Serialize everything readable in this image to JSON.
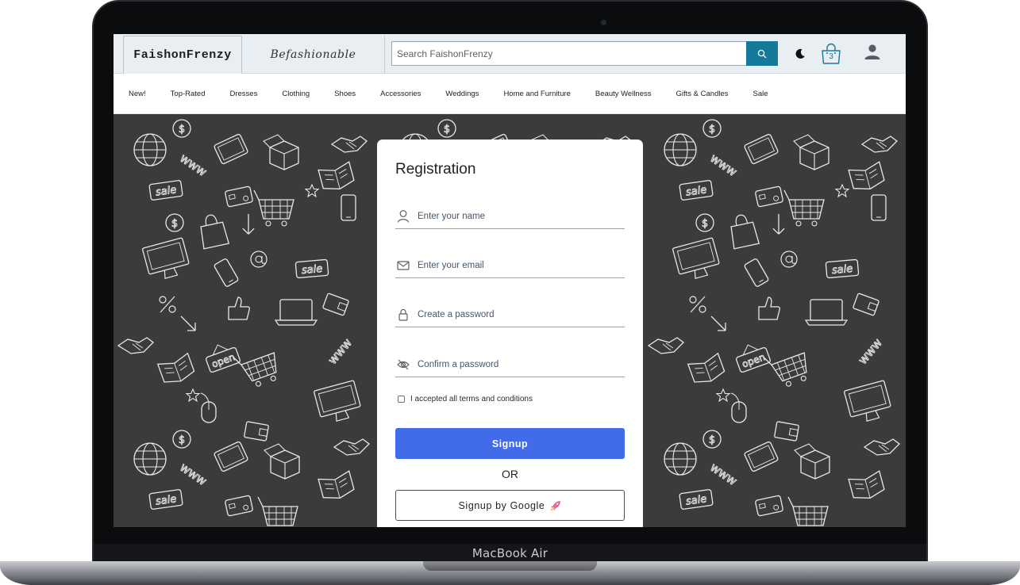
{
  "device": {
    "label": "MacBook Air"
  },
  "header": {
    "brand": "FaishonFrenzy",
    "tagline": "Befashionable",
    "search": {
      "placeholder": "Search FaishonFrenzy",
      "icon": "search-icon"
    },
    "theme_toggle_icon": "moon-icon",
    "cart": {
      "icon": "shopping-bag-icon",
      "count": "3"
    },
    "account_icon": "user-icon"
  },
  "nav": {
    "items": [
      {
        "label": "New!"
      },
      {
        "label": "Top-Rated"
      },
      {
        "label": "Dresses"
      },
      {
        "label": "Clothing"
      },
      {
        "label": "Shoes"
      },
      {
        "label": "Accessories"
      },
      {
        "label": "Weddings"
      },
      {
        "label": "Home and Furniture"
      },
      {
        "label": "Beauty Wellness"
      },
      {
        "label": "Gifts & Candles"
      },
      {
        "label": "Sale"
      }
    ]
  },
  "registration": {
    "title": "Registration",
    "fields": [
      {
        "icon": "user-icon",
        "placeholder": "Enter your name",
        "value": ""
      },
      {
        "icon": "envelope-icon",
        "placeholder": "Enter your email",
        "value": ""
      },
      {
        "icon": "lock-icon",
        "placeholder": "Create a password",
        "value": ""
      },
      {
        "icon": "eye-off-icon",
        "placeholder": "Confirm a password",
        "value": ""
      }
    ],
    "terms_label": "I accepted all terms and conditions",
    "terms_checked": false,
    "signup_label": "Signup",
    "or_label": "OR",
    "google_label": "Signup by Google",
    "google_icon": "rocket-icon"
  },
  "colors": {
    "accent": "#157a99",
    "signup_button": "#416be8",
    "background_pattern": "#3b3b3c",
    "header_bg": "#e9eef3"
  }
}
